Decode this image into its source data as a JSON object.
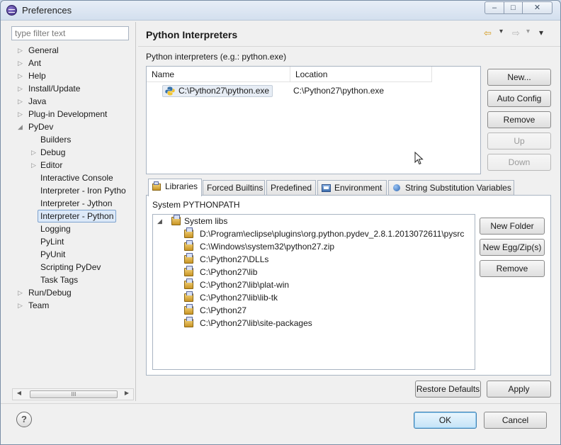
{
  "window": {
    "title": "Preferences",
    "minimize": "‒",
    "maximize": "□",
    "close": "✕"
  },
  "filter": {
    "placeholder": "type filter text"
  },
  "tree": {
    "items": [
      {
        "label": "General",
        "expanded": false,
        "level": 0
      },
      {
        "label": "Ant",
        "expanded": false,
        "level": 0
      },
      {
        "label": "Help",
        "expanded": false,
        "level": 0
      },
      {
        "label": "Install/Update",
        "expanded": false,
        "level": 0
      },
      {
        "label": "Java",
        "expanded": false,
        "level": 0
      },
      {
        "label": "Plug-in Development",
        "expanded": false,
        "level": 0
      },
      {
        "label": "PyDev",
        "expanded": true,
        "level": 0
      },
      {
        "label": "Builders",
        "level": 1
      },
      {
        "label": "Debug",
        "expanded": false,
        "level": 1
      },
      {
        "label": "Editor",
        "expanded": false,
        "level": 1
      },
      {
        "label": "Interactive Console",
        "level": 1
      },
      {
        "label": "Interpreter - Iron Pytho",
        "level": 1
      },
      {
        "label": "Interpreter - Jython",
        "level": 1
      },
      {
        "label": "Interpreter - Python",
        "level": 1,
        "selected": true
      },
      {
        "label": "Logging",
        "level": 1
      },
      {
        "label": "PyLint",
        "level": 1
      },
      {
        "label": "PyUnit",
        "level": 1
      },
      {
        "label": "Scripting PyDev",
        "level": 1
      },
      {
        "label": "Task Tags",
        "level": 1
      },
      {
        "label": "Run/Debug",
        "expanded": false,
        "level": 0
      },
      {
        "label": "Team",
        "expanded": false,
        "level": 0
      }
    ],
    "scroll_grip": "III"
  },
  "page": {
    "title": "Python Interpreters",
    "nav_back": "⇦",
    "nav_forward": "⇨",
    "menu": "▾",
    "interpreters_label": "Python interpreters (e.g.: python.exe)"
  },
  "interpreters_table": {
    "columns": [
      "Name",
      "Location"
    ],
    "rows": [
      {
        "name": "C:\\Python27\\python.exe",
        "location": "C:\\Python27\\python.exe"
      }
    ]
  },
  "interpreter_buttons": {
    "new": "New...",
    "auto_config": "Auto Config",
    "remove": "Remove",
    "up": "Up",
    "down": "Down"
  },
  "tabs": [
    {
      "label": "Libraries",
      "active": true
    },
    {
      "label": "Forced Builtins"
    },
    {
      "label": "Predefined"
    },
    {
      "label": "Environment"
    },
    {
      "label": "String Substitution Variables"
    }
  ],
  "libraries": {
    "section_label": "System PYTHONPATH",
    "root": "System libs",
    "paths": [
      "D:\\Program\\eclipse\\plugins\\org.python.pydev_2.8.1.2013072611\\pysrc",
      "C:\\Windows\\system32\\python27.zip",
      "C:\\Python27\\DLLs",
      "C:\\Python27\\lib",
      "C:\\Python27\\lib\\plat-win",
      "C:\\Python27\\lib\\lib-tk",
      "C:\\Python27",
      "C:\\Python27\\lib\\site-packages"
    ],
    "buttons": {
      "new_folder": "New Folder",
      "new_egg": "New Egg/Zip(s)",
      "remove": "Remove"
    }
  },
  "footer": {
    "restore_defaults": "Restore Defaults",
    "apply": "Apply",
    "help": "?",
    "ok": "OK",
    "cancel": "Cancel"
  }
}
